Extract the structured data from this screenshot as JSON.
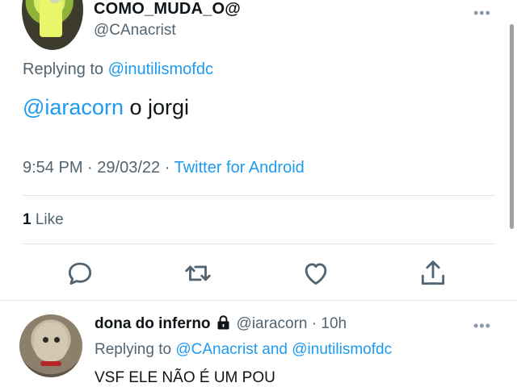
{
  "tweet": {
    "display_name": "COMO_MUDA_O@",
    "handle": "@CAnacrist",
    "replying_prefix": "Replying to",
    "replying_to": "@inutilismofdc",
    "mention": "@iaracorn",
    "text": "o jorgi",
    "time": "9:54 PM",
    "date": "29/03/22",
    "meta_sep": "·",
    "source": "Twitter for Android",
    "like_count": "1",
    "like_label": "Like",
    "more_icon": "more-icon"
  },
  "actions": [
    {
      "name": "reply-icon"
    },
    {
      "name": "retweet-icon"
    },
    {
      "name": "like-icon"
    },
    {
      "name": "share-icon"
    }
  ],
  "reply": {
    "display_name": "dona do inferno",
    "lock_icon": "lock-icon",
    "handle": "@iaracorn",
    "sep": "·",
    "time": "10h",
    "replying_prefix": "Replying to",
    "replying_to_1": "@CAnacrist",
    "and": "and",
    "replying_to_2": "@inutilismofdc",
    "text": "VSF ELE NÃO É UM POU"
  },
  "colors": {
    "link": "#1d9bf0",
    "secondary_text": "#536471",
    "primary_text": "#0f1419"
  }
}
